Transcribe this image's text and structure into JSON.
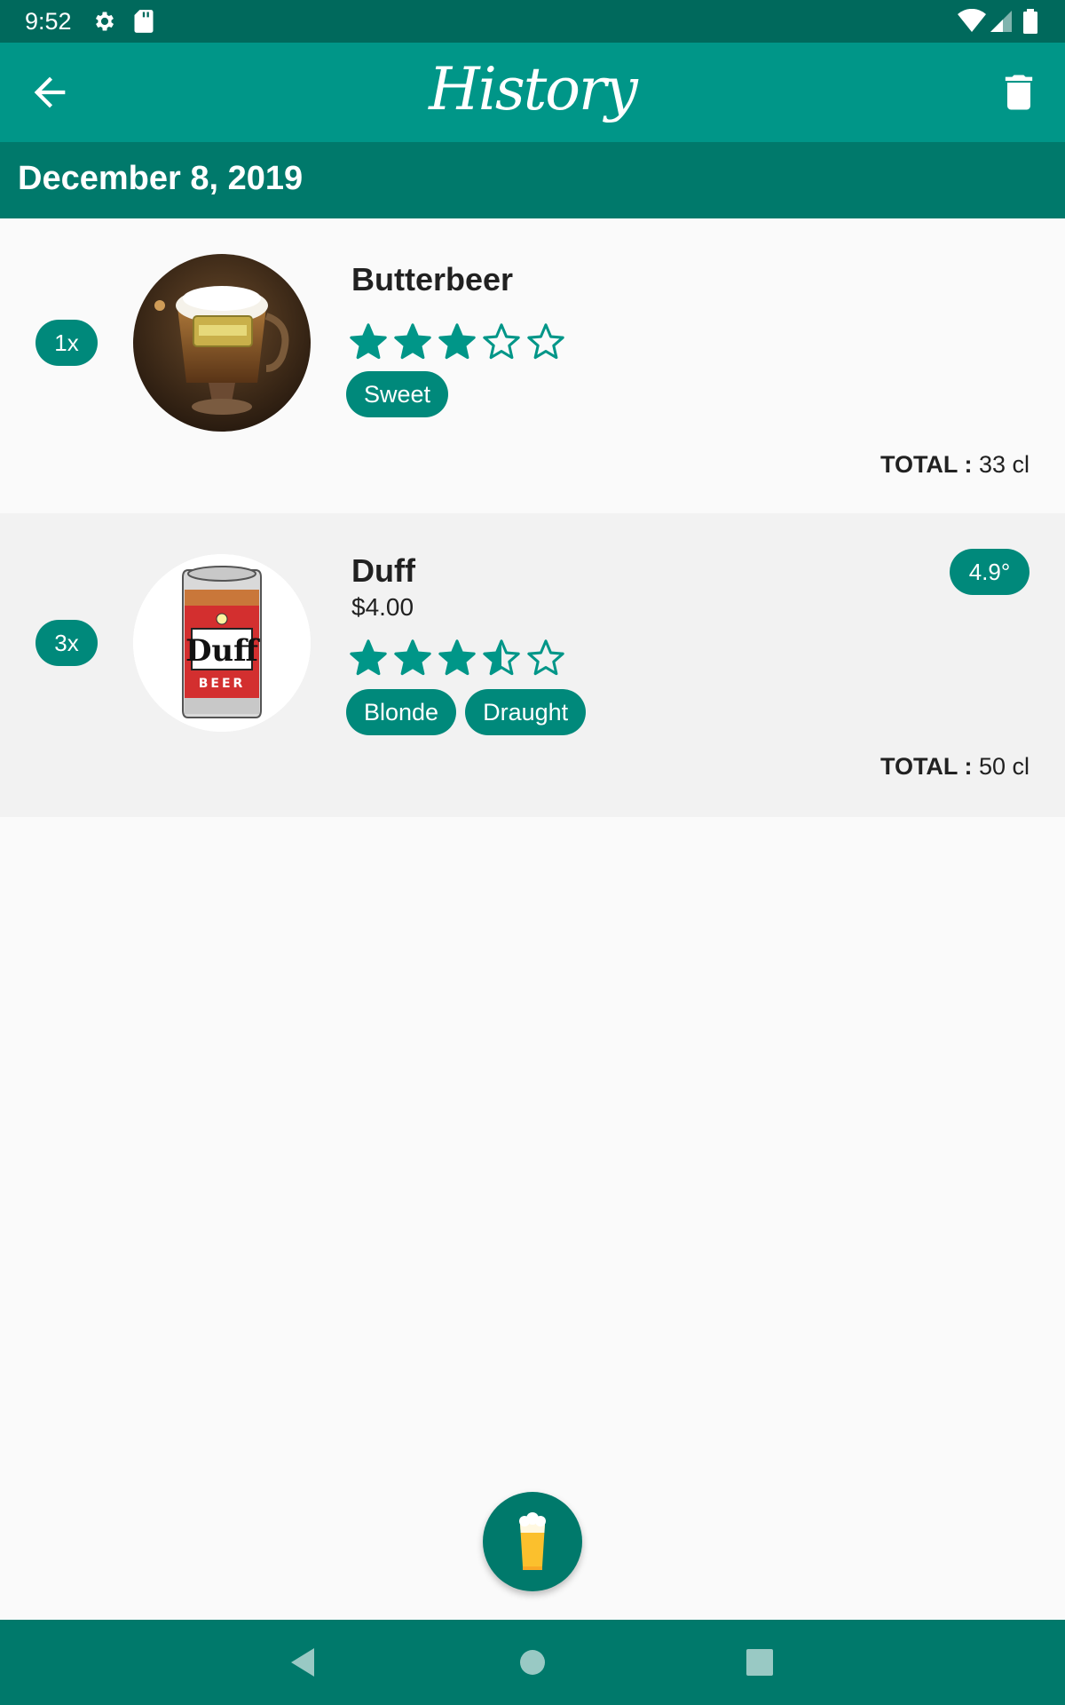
{
  "status_bar": {
    "time": "9:52",
    "icons": [
      "gear-icon",
      "sd-card-icon",
      "wifi-icon",
      "signal-icon",
      "battery-icon"
    ]
  },
  "toolbar": {
    "title": "History",
    "back_icon": "arrow-back-icon",
    "delete_icon": "trash-icon"
  },
  "date_header": "December 8, 2019",
  "entries": [
    {
      "quantity": "1x",
      "name": "Butterbeer",
      "rating": 3,
      "tags": [
        "Sweet"
      ],
      "total_label": "TOTAL :",
      "total_value": "33 cl"
    },
    {
      "quantity": "3x",
      "name": "Duff",
      "price": "$4.00",
      "abv": "4.9°",
      "rating": 3.5,
      "tags": [
        "Blonde",
        "Draught"
      ],
      "total_label": "TOTAL :",
      "total_value": "50 cl"
    }
  ],
  "fab_icon": "beer-glass-icon",
  "nav_bar": {
    "icons": [
      "back-triangle-icon",
      "home-circle-icon",
      "recents-square-icon"
    ]
  },
  "colors": {
    "primary": "#009688",
    "primary_dark": "#00796b",
    "status_bar": "#00695c",
    "accent": "#00897b"
  }
}
